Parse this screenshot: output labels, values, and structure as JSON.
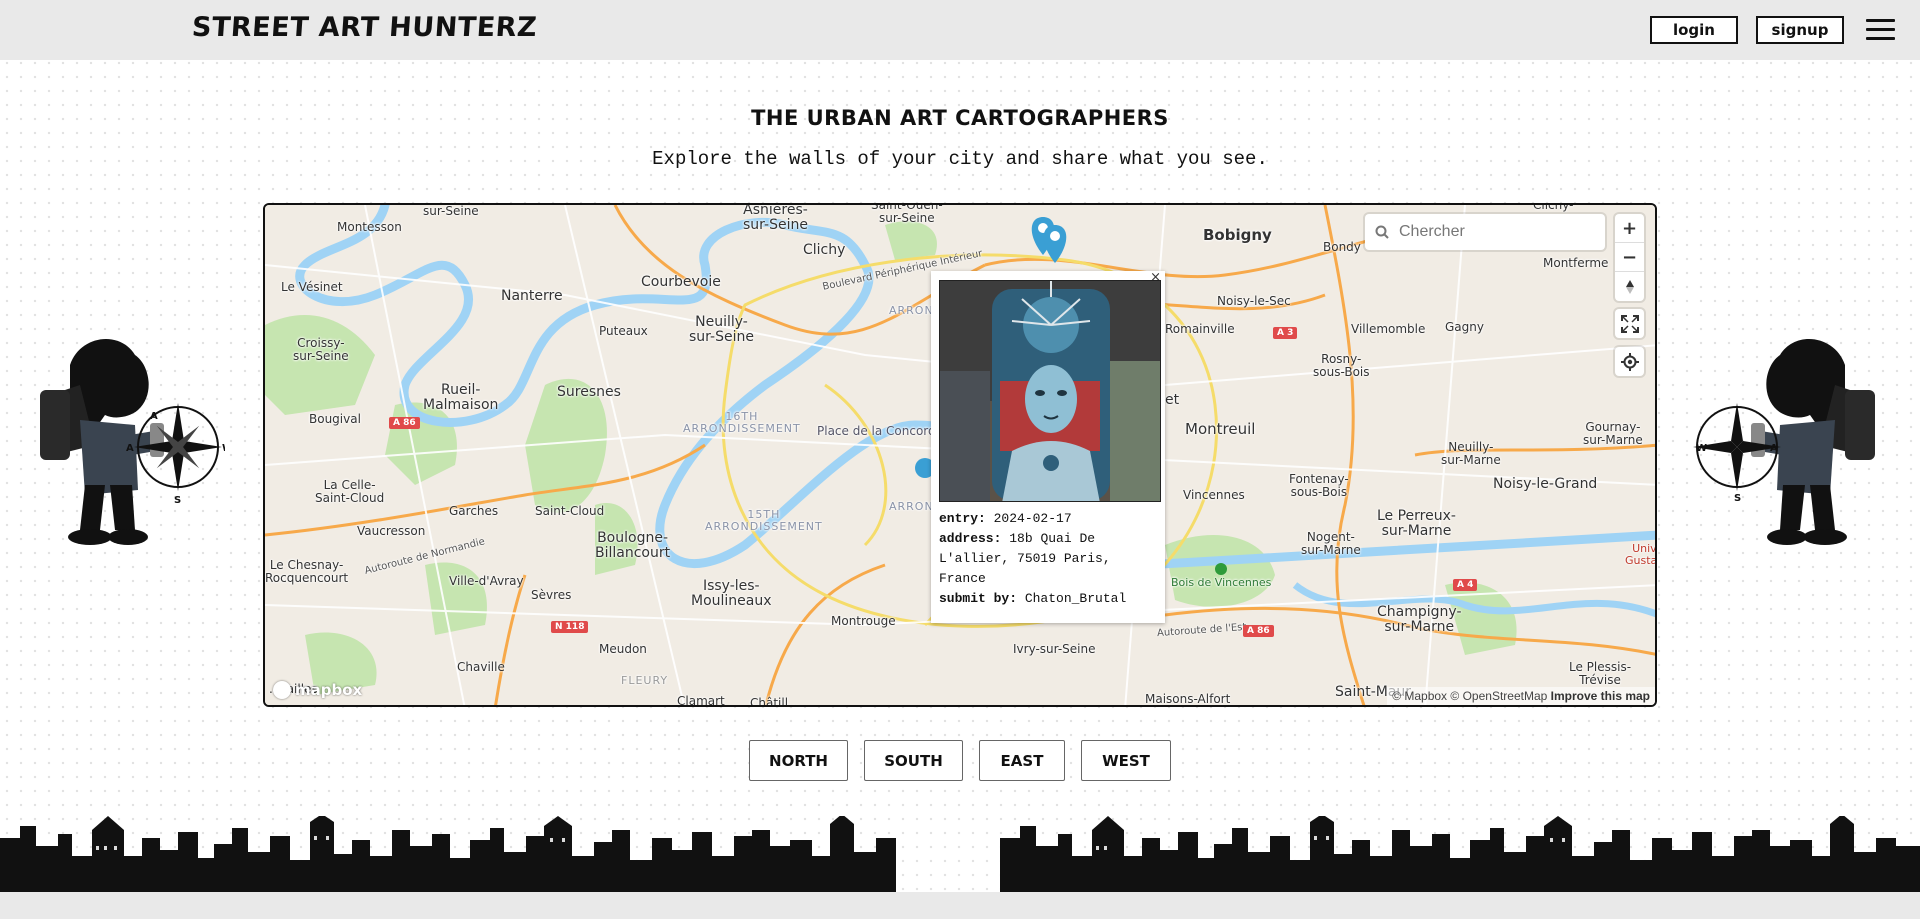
{
  "header": {
    "logo": "STREET ART HUNTERZ",
    "login_label": "login",
    "signup_label": "signup"
  },
  "hero": {
    "title": "THE URBAN ART CARTOGRAPHERS",
    "subtitle": "Explore the walls of your city and share what you see."
  },
  "map": {
    "search_placeholder": "Chercher",
    "zoom_in": "+",
    "zoom_out": "−",
    "attribution_mapbox": "© Mapbox",
    "attribution_osm": "© OpenStreetMap",
    "attribution_improve": "Improve this map",
    "logo_text": "mapbox",
    "places": {
      "montesson": "Montesson",
      "sur_seine_top": "sur-Seine",
      "asnieres": "Asnières-\nsur-Seine",
      "saint_ouen": "Saint-Ouen-\nsur-Seine",
      "clichy_top": "Clichy-",
      "bobigny": "Bobigny",
      "bondy": "Bondy",
      "montferme": "Montferme",
      "le_vesinet": "Le Vésinet",
      "clichy": "Clichy",
      "courbevoie": "Courbevoie",
      "nanterre": "Nanterre",
      "neuilly": "Neuilly-\nsur-Seine",
      "puteaux": "Puteaux",
      "croissy": "Croissy-\nsur-Seine",
      "noisy_le_sec": "Noisy-le-Sec",
      "romainville": "Romainville",
      "villemomble": "Villemomble",
      "gagny": "Gagny",
      "rosny": "Rosny-\nsous-Bois",
      "rueil": "Rueil-\nMalmaison",
      "suresnes": "Suresnes",
      "bougival": "Bougival",
      "arr16": "16TH\nARRONDISSEMENT",
      "concorde": "Place de la Concorde",
      "montreuil": "Montreuil",
      "neuilly_marne": "Neuilly-\nsur-Marne",
      "gournay": "Gournay-\nsur-Marne",
      "la_celle": "La Celle-\nSaint-Cloud",
      "garches": "Garches",
      "saint_cloud": "Saint-Cloud",
      "vaucresson": "Vaucresson",
      "arr15": "15TH\nARRONDISSEMENT",
      "boulogne": "Boulogne-\nBillancourt",
      "vincennes": "Vincennes",
      "fontenay": "Fontenay-\nsous-Bois",
      "perreux": "Le Perreux-\nsur-Marne",
      "noisy_grand": "Noisy-le-Grand",
      "nogent": "Nogent-\nsur-Marne",
      "chesnay": "Le Chesnay-\nRocquencourt",
      "ville_avray": "Ville-d'Avray",
      "sevres": "Sèvres",
      "issy": "Issy-les-\nMoulineaux",
      "montrouge": "Montrouge",
      "bois_vincennes": "Bois de Vincennes",
      "champigny": "Champigny-\nsur-Marne",
      "meudon": "Meudon",
      "ivry": "Ivry-sur-Seine",
      "chaville": "Chaville",
      "fleury": "FLEURY",
      "clamart": "Clamart",
      "chatillon": "Châtill...",
      "maisons_alfort": "Maisons-Alfort",
      "saint_maur": "Saint-Maur",
      "plessis": "Le Plessis-\nTrévise",
      "versailles": "...sailles",
      "arron_a": "ARRON",
      "arron_b": "ARRON",
      "et": "et",
      "unive": "Unive\nGustave",
      "peripherique": "Boulevard Périphérique Intérieur",
      "autoroute_normandie": "Autoroute de Normandie",
      "autoroute_est": "Autoroute de l'Est"
    },
    "shields": {
      "a86_left": "A 86",
      "a3": "A 3",
      "n118": "N 118",
      "a86_right": "A 86",
      "a4": "A 4"
    },
    "popup": {
      "close": "×",
      "entry_label": "entry:",
      "entry_value": "2024-02-17",
      "address_label": "address:",
      "address_value": "18b Quai De L'allier, 75019 Paris, France",
      "submit_label": "submit by:",
      "submit_value": "Chaton_Brutal"
    }
  },
  "directions": {
    "north": "NORTH",
    "south": "SOUTH",
    "east": "EAST",
    "west": "WEST"
  },
  "compass": {
    "n": "N",
    "e": "E",
    "s": "S",
    "w": "W",
    "a": "A"
  },
  "colors": {
    "header_bg": "#e9e9e9",
    "map_water": "#9fd3f5",
    "map_park": "#c6e5b0",
    "map_major_road": "#f7a94a",
    "map_yellow_road": "#f5dc6a",
    "marker": "#3a9fd4"
  }
}
